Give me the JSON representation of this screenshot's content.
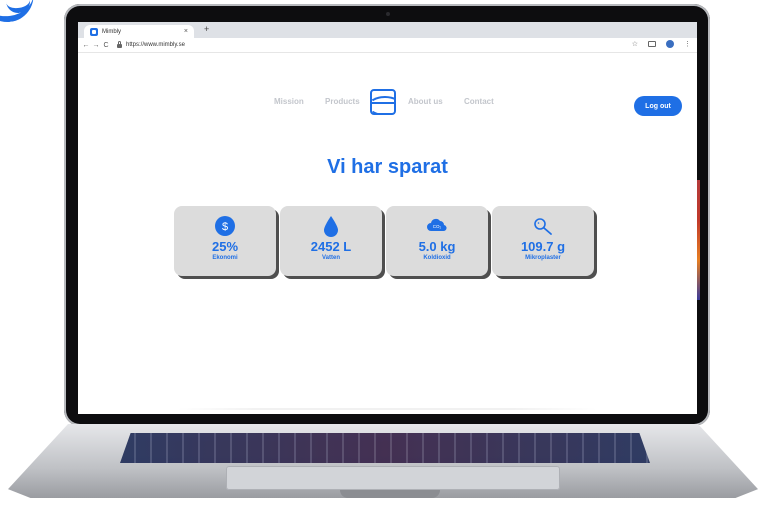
{
  "browser": {
    "tab_title": "Mimbly",
    "tab_close": "×",
    "new_tab": "+",
    "back": "←",
    "forward": "→",
    "reload": "C",
    "url": "https://www.mimbly.se",
    "star": "☆",
    "menu": "⋮"
  },
  "nav": {
    "links": [
      "Mission",
      "Products",
      "About us",
      "Contact"
    ],
    "logout_label": "Log out"
  },
  "headline": "Vi har sparat",
  "stats": [
    {
      "value": "25%",
      "label": "Ekonomi",
      "icon": "dollar-icon"
    },
    {
      "value": "2452 L",
      "label": "Vatten",
      "icon": "water-drop-icon"
    },
    {
      "value": "5.0 kg",
      "label": "Koldioxid",
      "icon": "co2-cloud-icon"
    },
    {
      "value": "109.7 g",
      "label": "Mikroplaster",
      "icon": "magnifier-icon"
    }
  ],
  "colors": {
    "accent": "#1f6fe5",
    "card_bg": "#dcdcdc",
    "nav_text": "#c3c6cc"
  }
}
